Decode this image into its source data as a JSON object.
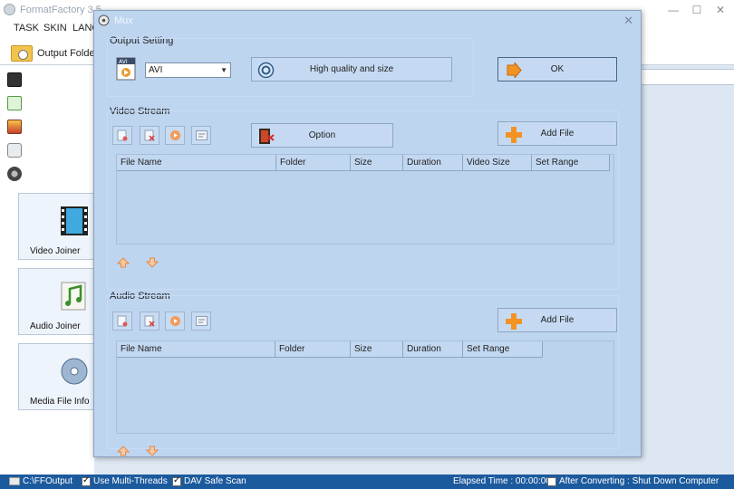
{
  "main_window": {
    "title": "FormatFactory 3.5",
    "menu": [
      "TASK",
      "SKIN",
      "LANG"
    ],
    "output_folder_label": "Output Folder",
    "sidebar_tiles": [
      {
        "label": "Video Joiner",
        "icon": "film-strip-icon"
      },
      {
        "label": "Audio Joiner",
        "icon": "music-note-icon"
      },
      {
        "label": "Media File Info",
        "icon": "disc-icon"
      }
    ]
  },
  "status_bar": {
    "output_path": "C:\\FFOutput",
    "multi_threads": "Use Multi-Threads",
    "multi_threads_checked": true,
    "dav_safe_scan": "DAV Safe Scan",
    "dav_checked": true,
    "elapsed_time": "Elapsed Time : 00:00:00",
    "after_converting": "After Converting : Shut Down Computer",
    "after_converting_checked": false
  },
  "dialog": {
    "title": "Mux",
    "output_setting": {
      "group_label": "Output Setting",
      "format_value": "AVI",
      "quality_button_label": "High quality and size",
      "ok_label": "OK"
    },
    "video_stream": {
      "group_label": "Video Stream",
      "option_label": "Option",
      "add_file_label": "Add File",
      "columns": [
        "File Name",
        "Folder",
        "Size",
        "Duration",
        "Video Size",
        "Set Range"
      ]
    },
    "audio_stream": {
      "group_label": "Audio Stream",
      "add_file_label": "Add File",
      "columns": [
        "File Name",
        "Folder",
        "Size",
        "Duration",
        "Set Range"
      ]
    }
  },
  "colors": {
    "dialog_bg": "#bed5f0",
    "status_bar": "#1c5a9e",
    "plus_orange": "#f29324"
  }
}
